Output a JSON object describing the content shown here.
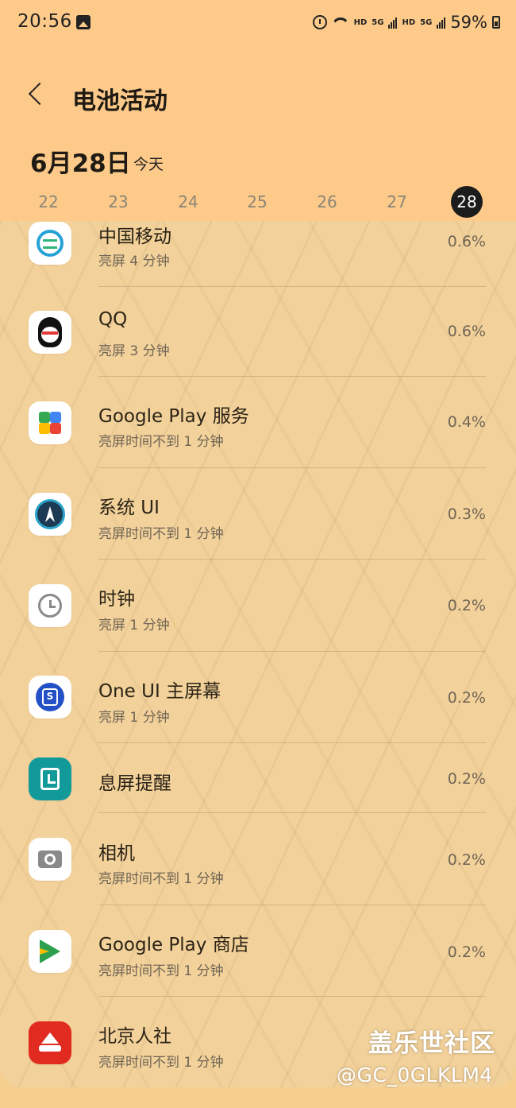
{
  "status_bar": {
    "time": "20:56",
    "hd1": "HD",
    "sig1": "5G",
    "hd2": "HD",
    "sig2": "5G",
    "battery": "59%"
  },
  "header": {
    "title": "电池活动",
    "date": "6月28日",
    "date_sub": "今天",
    "days": [
      "22",
      "23",
      "24",
      "25",
      "26",
      "27",
      "28"
    ],
    "selected_day": "28"
  },
  "apps": [
    {
      "name": "中国移动",
      "sub": "亮屏 4 分钟",
      "pct": "0.6%",
      "icon": "china-mobile-icon"
    },
    {
      "name": "QQ",
      "sub": "亮屏 3 分钟",
      "pct": "0.6%",
      "icon": "qq-icon"
    },
    {
      "name": "Google Play 服务",
      "sub": "亮屏时间不到 1 分钟",
      "pct": "0.4%",
      "icon": "google-play-services-icon"
    },
    {
      "name": "系统 UI",
      "sub": "亮屏时间不到 1 分钟",
      "pct": "0.3%",
      "icon": "system-ui-icon"
    },
    {
      "name": "时钟",
      "sub": "亮屏 1 分钟",
      "pct": "0.2%",
      "icon": "clock-icon"
    },
    {
      "name": "One UI 主屏幕",
      "sub": "亮屏 1 分钟",
      "pct": "0.2%",
      "icon": "one-ui-home-icon"
    },
    {
      "name": "息屏提醒",
      "sub": "",
      "pct": "0.2%",
      "icon": "always-on-display-icon"
    },
    {
      "name": "相机",
      "sub": "亮屏时间不到 1 分钟",
      "pct": "0.2%",
      "icon": "camera-icon"
    },
    {
      "name": "Google Play 商店",
      "sub": "亮屏时间不到 1 分钟",
      "pct": "0.2%",
      "icon": "google-play-store-icon"
    },
    {
      "name": "北京人社",
      "sub": "亮屏时间不到 1 分钟",
      "pct": "",
      "icon": "beijing-renshe-icon"
    }
  ],
  "watermark": {
    "line1": "盖乐世社区",
    "line2": "@GC_0GLKLM4"
  }
}
